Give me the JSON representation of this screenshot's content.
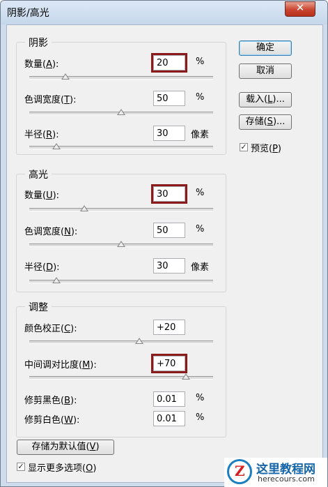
{
  "window": {
    "title": "阴影/高光"
  },
  "shadows": {
    "title": "阴影",
    "amount": {
      "label": "数量(",
      "key": "A",
      "suffix": "):",
      "value": "20",
      "unit": "%",
      "slider": 0.2
    },
    "tonal_width": {
      "label": "色调宽度(",
      "key": "T",
      "suffix": "):",
      "value": "50",
      "unit": "%",
      "slider": 0.5
    },
    "radius": {
      "label": "半径(",
      "key": "R",
      "suffix": "):",
      "value": "30",
      "unit": "像素",
      "slider": 0.15
    }
  },
  "highlights": {
    "title": "高光",
    "amount": {
      "label": "数量(",
      "key": "U",
      "suffix": "):",
      "value": "30",
      "unit": "%",
      "slider": 0.3
    },
    "tonal_width": {
      "label": "色调宽度(",
      "key": "N",
      "suffix": "):",
      "value": "50",
      "unit": "%",
      "slider": 0.5
    },
    "radius": {
      "label": "半径(",
      "key": "D",
      "suffix": "):",
      "value": "30",
      "unit": "像素",
      "slider": 0.15
    }
  },
  "adjustments": {
    "title": "调整",
    "color_correction": {
      "label": "颜色校正(",
      "key": "C",
      "suffix": "):",
      "value": "+20",
      "slider": 0.6
    },
    "midtone_contrast": {
      "label": "中间调对比度(",
      "key": "M",
      "suffix": "):",
      "value": "+70",
      "slider": 0.85
    },
    "black_clip": {
      "label": "修剪黑色(",
      "key": "B",
      "suffix": "):",
      "value": "0.01",
      "unit": "%"
    },
    "white_clip": {
      "label": "修剪白色(",
      "key": "W",
      "suffix": "):",
      "value": "0.01",
      "unit": "%"
    }
  },
  "buttons": {
    "ok": {
      "label": "确定"
    },
    "cancel": {
      "label": "取消"
    },
    "load": {
      "label": "载入(",
      "key": "L",
      "suffix": ")..."
    },
    "save": {
      "label": "存储(",
      "key": "S",
      "suffix": ")..."
    },
    "save_default": {
      "label": "存储为默认值(",
      "key": "V",
      "suffix": ")"
    }
  },
  "preview": {
    "label": "预览(",
    "key": "P",
    "suffix": ")",
    "checked": true
  },
  "more_options": {
    "label": "显示更多选项(",
    "key": "O",
    "suffix": ")",
    "checked": true
  },
  "watermark": {
    "line1": "这里教程网",
    "line2": "herecours.com"
  }
}
